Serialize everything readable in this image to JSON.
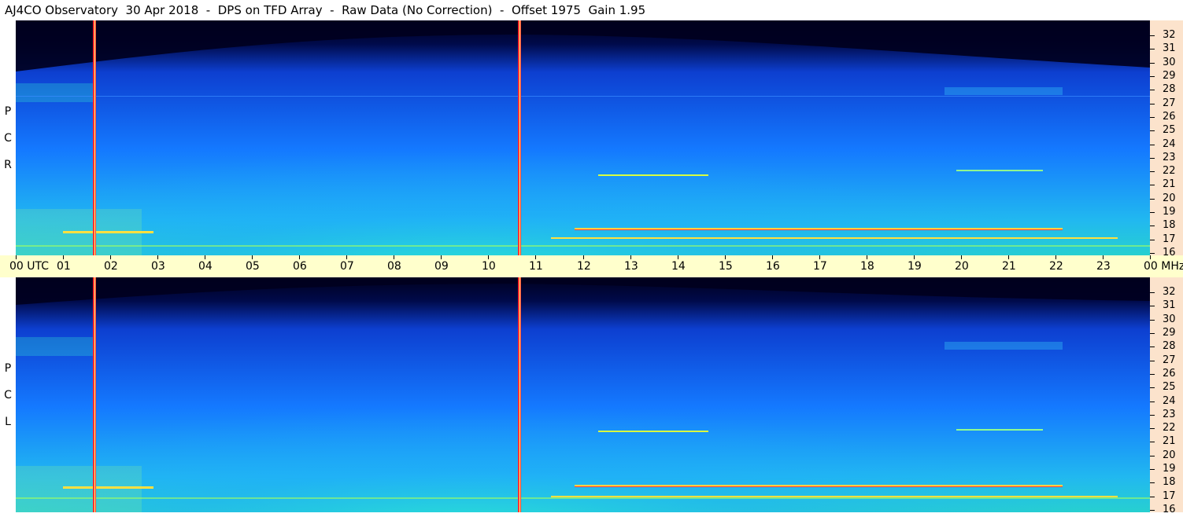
{
  "title": "AJ4CO Observatory  30 Apr 2018  -  DPS on TFD Array  -  Raw Data (No Correction)  -  Offset 1975  Gain 1.95",
  "panels": [
    {
      "id": "rcp",
      "letters": [
        "R",
        "C",
        "P"
      ]
    },
    {
      "id": "lcp",
      "letters": [
        "L",
        "C",
        "P"
      ]
    }
  ],
  "freq_labels": [
    "32",
    "31",
    "30",
    "29",
    "28",
    "27",
    "26",
    "25",
    "24",
    "23",
    "22",
    "21",
    "20",
    "19",
    "18",
    "17",
    "16"
  ],
  "time_axis": {
    "labels": [
      "00 UTC",
      "01",
      "02",
      "03",
      "04",
      "05",
      "06",
      "07",
      "08",
      "09",
      "10",
      "11",
      "12",
      "13",
      "14",
      "15",
      "16",
      "17",
      "18",
      "19",
      "20",
      "21",
      "22",
      "23",
      "00 MHz"
    ]
  },
  "colors": {
    "background_dark": "#000022",
    "spectrum_base": "#1e6cff",
    "spectrum_low": "#27d7e6",
    "time_bar": "#ffffcc",
    "freq_scale": "#fce3cc"
  }
}
